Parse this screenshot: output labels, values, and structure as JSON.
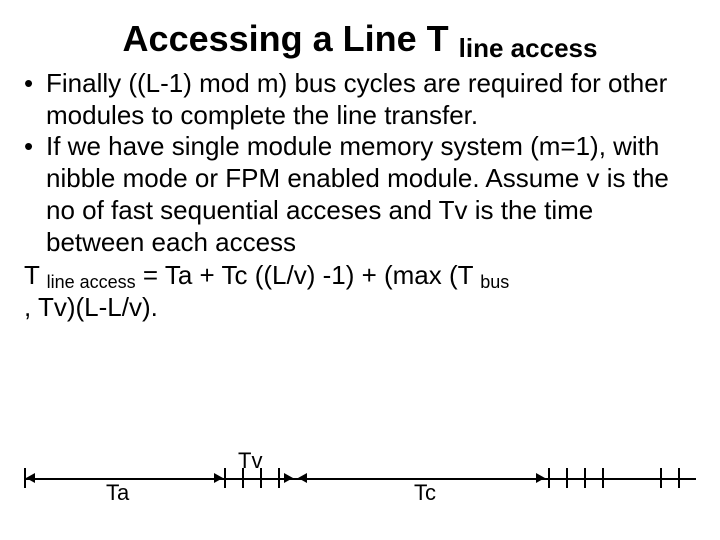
{
  "title": {
    "main": "Accessing a Line T ",
    "sub": "line access"
  },
  "bullets": [
    "Finally ((L-1) mod m) bus cycles are required for other modules to complete the line transfer.",
    "If we have single module memory system (m=1), with nibble mode or FPM enabled module. Assume v is the no of fast sequential acceses  and Tv is the time between each access"
  ],
  "formula": {
    "lhs_t": "T ",
    "lhs_sub": "line access",
    "mid": " = Ta + Tc ((L/v) -1) + (max (T ",
    "bus_sub": "bus",
    "tail": " , Tv)(L-L/v)."
  },
  "diagram": {
    "labels": {
      "ta": "Ta",
      "tv": "Tv",
      "tc": "Tc"
    }
  }
}
